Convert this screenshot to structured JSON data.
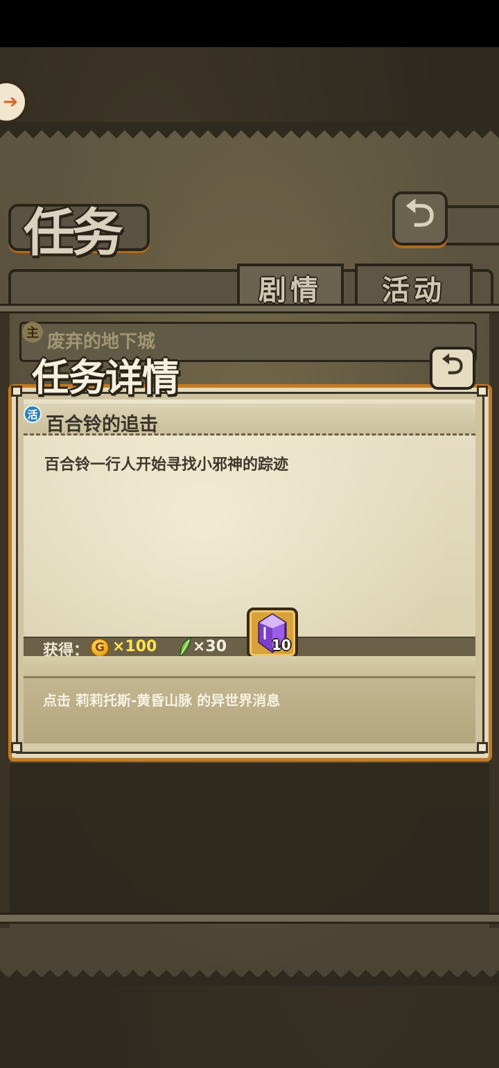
{
  "screen": {
    "title": "任务",
    "tabs": [
      {
        "label": "剧情"
      },
      {
        "label": "活动"
      }
    ],
    "list": [
      {
        "badge": "主",
        "title": "废弃的地下城"
      }
    ]
  },
  "detail": {
    "heading": "任务详情",
    "quest": {
      "badge": "活",
      "title": "百合铃的追击",
      "description": "百合铃一行人开始寻找小邪神的踪迹"
    },
    "rewards": {
      "label": "获得：",
      "coin_symbol": "G",
      "coin_amount": "×100",
      "feather_amount": "×30",
      "crystal_count": "10"
    },
    "hint": "点击 莉莉托斯-黄昏山脉 的异世界消息"
  },
  "colors": {
    "panel_border": "#c47a23",
    "coin": "#e9a313",
    "coin_text": "#ffe34d",
    "crystal": "#9b5de5",
    "quest_badge": "#2c7fb8"
  },
  "icons": {
    "corner": "arrow-right-icon",
    "back": "return-arrow-icon",
    "coin": "gold-coin-icon",
    "feather": "feather-icon",
    "crystal": "purple-crystal-icon"
  }
}
